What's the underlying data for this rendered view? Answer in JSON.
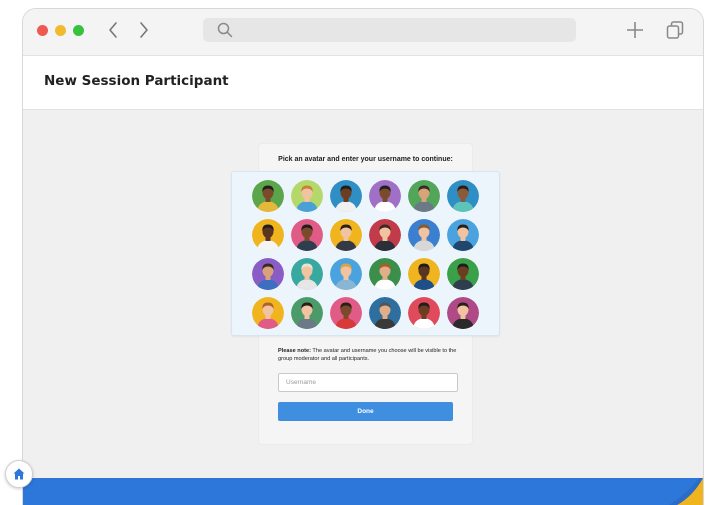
{
  "browser": {
    "icons": [
      "chevron-left-icon",
      "chevron-right-icon",
      "search-icon",
      "plus-icon",
      "tabs-icon"
    ],
    "traffic_lights": {
      "close": "#ee5a52",
      "minimize": "#f2bb2e",
      "maximize": "#37c23d"
    }
  },
  "page": {
    "title": "New Session Participant"
  },
  "form": {
    "prompt": "Pick an avatar and enter your username to continue:",
    "note_bold": "Please note:",
    "note_text": " The avatar and username you choose will be visible to the group moderator and all participants.",
    "username_placeholder": "Username",
    "username_value": "",
    "done_label": "Done"
  },
  "avatars": [
    {
      "bg": "#5ba54a",
      "skin": "#7a4a2a",
      "hair": "#1e1e1e",
      "shirt": "#e6b83a"
    },
    {
      "bg": "#b5d86a",
      "skin": "#f2c3a0",
      "hair": "#c8803a",
      "shirt": "#4a9fd6"
    },
    {
      "bg": "#2f8ec3",
      "skin": "#6b3e22",
      "hair": "#1e1e1e",
      "shirt": "#f0f0f0"
    },
    {
      "bg": "#a070c6",
      "skin": "#7a4a2a",
      "hair": "#1e1e1e",
      "shirt": "#ffffff"
    },
    {
      "bg": "#52a65a",
      "skin": "#d9a27a",
      "hair": "#3a2b20",
      "shirt": "#6c7a86"
    },
    {
      "bg": "#2f8ec3",
      "skin": "#8a5a3a",
      "hair": "#2a1f18",
      "shirt": "#5cc4b8"
    },
    {
      "bg": "#f0b41e",
      "skin": "#5a3520",
      "hair": "#1e1e1e",
      "shirt": "#f5f5f5"
    },
    {
      "bg": "#e05b86",
      "skin": "#7a4a2a",
      "hair": "#1e1e1e",
      "shirt": "#2f3e4e"
    },
    {
      "bg": "#f0b41e",
      "skin": "#f2c3a0",
      "hair": "#2a1f18",
      "shirt": "#333a44"
    },
    {
      "bg": "#c23b4a",
      "skin": "#f2c3a0",
      "hair": "#3a2b20",
      "shirt": "#2a2f38"
    },
    {
      "bg": "#3a7fd0",
      "skin": "#f2c3a0",
      "hair": "#8a5a2a",
      "shirt": "#d8d8d8"
    },
    {
      "bg": "#4aa3de",
      "skin": "#f2c3a0",
      "hair": "#2a1f18",
      "shirt": "#20466e"
    },
    {
      "bg": "#8a5cc6",
      "skin": "#d9a27a",
      "hair": "#3a2b20",
      "shirt": "#3c6fbf"
    },
    {
      "bg": "#38a9a0",
      "skin": "#f2c3a0",
      "hair": "#e8e2d6",
      "shirt": "#e6e6e6"
    },
    {
      "bg": "#4aa3de",
      "skin": "#f2c3a0",
      "hair": "#d8a44a",
      "shirt": "#8ab6d6"
    },
    {
      "bg": "#3b8f4a",
      "skin": "#e0ae88",
      "hair": "#b05a2a",
      "shirt": "#ffffff"
    },
    {
      "bg": "#f0b41e",
      "skin": "#5a3520",
      "hair": "#1e1e1e",
      "shirt": "#1f4f8a"
    },
    {
      "bg": "#3aa04a",
      "skin": "#6b3e22",
      "hair": "#1e1e1e",
      "shirt": "#2f3e4e"
    },
    {
      "bg": "#f0b41e",
      "skin": "#f2c3a0",
      "hair": "#b0602a",
      "shirt": "#e05b86"
    },
    {
      "bg": "#4a9a6a",
      "skin": "#f2c3a0",
      "hair": "#2a1f18",
      "shirt": "#6c7a86"
    },
    {
      "bg": "#e05b86",
      "skin": "#7a4a2a",
      "hair": "#2a1f18",
      "shirt": "#d83a3a"
    },
    {
      "bg": "#2f6fa0",
      "skin": "#e0ae88",
      "hair": "#555555",
      "shirt": "#3a3a3a"
    },
    {
      "bg": "#e04a5a",
      "skin": "#6b3e22",
      "hair": "#1e1e1e",
      "shirt": "#ffffff"
    },
    {
      "bg": "#b04a86",
      "skin": "#f2c3a0",
      "hair": "#2a1f18",
      "shirt": "#2a2a2a"
    }
  ],
  "footer": {
    "home_icon": "home-icon",
    "bar_color": "#2d76da",
    "accent_color": "#f0b41e"
  }
}
